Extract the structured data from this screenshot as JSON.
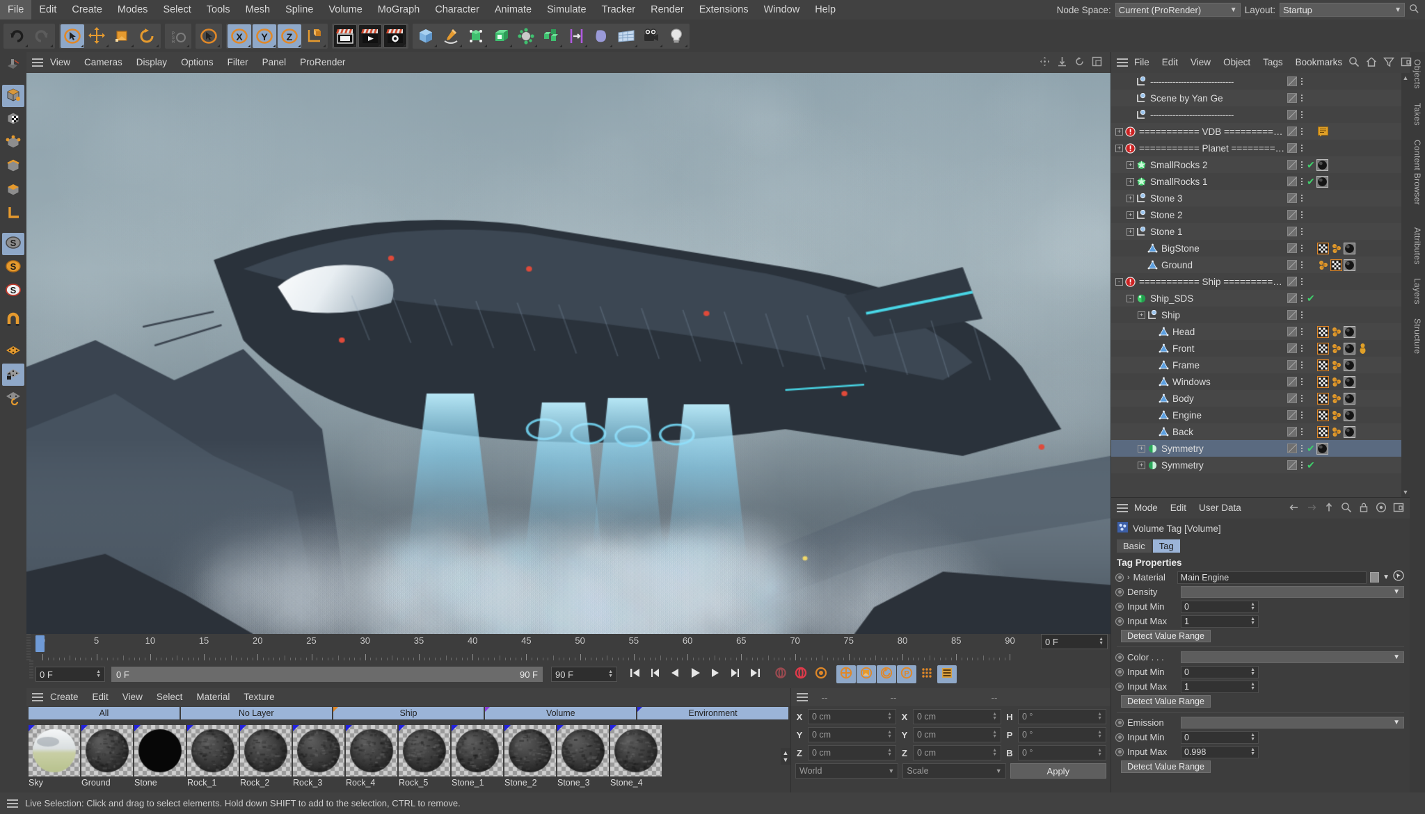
{
  "app": {
    "menubar": [
      "File",
      "Edit",
      "Create",
      "Modes",
      "Select",
      "Tools",
      "Mesh",
      "Spline",
      "Volume",
      "MoGraph",
      "Character",
      "Animate",
      "Simulate",
      "Tracker",
      "Render",
      "Extensions",
      "Window",
      "Help"
    ],
    "node_space_label": "Node Space:",
    "node_space_value": "Current (ProRender)",
    "layout_label": "Layout:",
    "layout_value": "Startup",
    "search_icon": "search-icon"
  },
  "toolbar": {
    "groups": [
      {
        "name": "history",
        "buttons": [
          {
            "icon": "undo-icon",
            "active": false
          },
          {
            "icon": "redo-icon",
            "active": false
          }
        ]
      },
      {
        "name": "transform",
        "buttons": [
          {
            "icon": "live-selection-icon",
            "active": true
          },
          {
            "icon": "move-icon",
            "active": false
          },
          {
            "icon": "scale-icon",
            "active": false
          },
          {
            "icon": "rotate-icon",
            "active": false
          }
        ]
      },
      {
        "name": "workplane",
        "buttons": [
          {
            "icon": "workplane-icon",
            "active": false
          }
        ]
      },
      {
        "name": "selection",
        "buttons": [
          {
            "icon": "cursor-select-icon",
            "active": false
          }
        ]
      },
      {
        "name": "axes",
        "buttons": [
          {
            "icon": "axis-x-icon",
            "active": true
          },
          {
            "icon": "axis-y-icon",
            "active": true
          },
          {
            "icon": "axis-z-icon",
            "active": true
          },
          {
            "icon": "world-object-axis-icon",
            "active": false
          }
        ]
      },
      {
        "name": "render",
        "buttons": [
          {
            "icon": "render-view-icon",
            "active": false
          },
          {
            "icon": "render-queue-icon",
            "active": false
          },
          {
            "icon": "render-settings-icon",
            "active": false
          }
        ]
      },
      {
        "name": "primitives",
        "buttons": [
          {
            "icon": "cube-icon",
            "active": false
          },
          {
            "icon": "pen-spline-icon",
            "active": false
          },
          {
            "icon": "nurbs-icon",
            "active": false
          },
          {
            "icon": "array-icon",
            "active": false
          },
          {
            "icon": "mograph-icon",
            "active": false
          },
          {
            "icon": "cloner-icon",
            "active": false
          },
          {
            "icon": "deformer-icon",
            "active": false
          },
          {
            "icon": "field-icon",
            "active": false
          },
          {
            "icon": "environment-icon",
            "active": false
          },
          {
            "icon": "camera-icon",
            "active": false
          },
          {
            "icon": "light-icon",
            "active": false
          }
        ]
      }
    ]
  },
  "left_rail": [
    {
      "icon": "texture-axis-icon",
      "active": false
    },
    {
      "icon": "model-mode-icon",
      "active": true
    },
    {
      "icon": "texture-mode-icon",
      "active": false
    },
    {
      "icon": "points-mode-icon",
      "active": false
    },
    {
      "icon": "edges-mode-icon",
      "active": false
    },
    {
      "icon": "polygons-mode-icon",
      "active": false
    },
    {
      "icon": "axis-mode-icon",
      "active": false
    },
    {
      "icon": "enable-axis-icon",
      "active": true
    },
    {
      "icon": "soft-selection-icon",
      "active": false
    },
    {
      "icon": "snap-toggle-icon",
      "active": false
    },
    {
      "icon": "magnet-icon",
      "active": false
    },
    {
      "icon": "workplane-grid-icon",
      "active": false
    },
    {
      "icon": "workplane-lock-icon",
      "active": true
    },
    {
      "icon": "workplane-rotate-icon",
      "active": false
    }
  ],
  "viewport": {
    "menu": [
      "View",
      "Cameras",
      "Display",
      "Options",
      "Filter",
      "Panel",
      "ProRender"
    ],
    "right_icons": [
      "pan-icon",
      "dolly-icon",
      "rotate-view-icon",
      "maximize-view-icon"
    ]
  },
  "timeline": {
    "ticks": [
      0,
      5,
      10,
      15,
      20,
      25,
      30,
      35,
      40,
      45,
      50,
      55,
      60,
      65,
      70,
      75,
      80,
      85,
      90
    ],
    "playhead_frame": 0,
    "current_frame": "0 F",
    "range_start": "0 F",
    "range_end": "90 F",
    "preview_min": "90 F",
    "preview_max": "90 F",
    "end_field": "0 F",
    "transport": [
      {
        "icon": "go-to-start-icon",
        "style": "plain"
      },
      {
        "icon": "rewind-to-previous-key-icon",
        "style": "plain"
      },
      {
        "icon": "step-back-icon",
        "style": "plain"
      },
      {
        "icon": "play-icon",
        "style": "plain"
      },
      {
        "icon": "step-forward-icon",
        "style": "plain"
      },
      {
        "icon": "forward-to-next-key-icon",
        "style": "plain"
      },
      {
        "icon": "go-to-end-icon",
        "style": "plain"
      },
      {
        "icon": "record-active-objects-icon",
        "style": "plain"
      },
      {
        "icon": "autokeying-icon",
        "style": "plain"
      },
      {
        "icon": "keyframe-selection-icon",
        "style": "plain"
      },
      {
        "icon": "position-key-icon",
        "style": "blue"
      },
      {
        "icon": "scale-key-icon",
        "style": "blue"
      },
      {
        "icon": "rotation-key-icon",
        "style": "blue"
      },
      {
        "icon": "parameter-key-icon",
        "style": "blue"
      },
      {
        "icon": "point-level-animation-icon",
        "style": "plain"
      },
      {
        "icon": "timeline-toggle-icon",
        "style": "blue"
      }
    ]
  },
  "material_manager": {
    "menu": [
      "Create",
      "Edit",
      "View",
      "Select",
      "Material",
      "Texture"
    ],
    "layer_tabs": [
      "All",
      "No Layer",
      "Ship",
      "Volume",
      "Environment"
    ],
    "materials": [
      {
        "name": "Sky",
        "swatch": "sky"
      },
      {
        "name": "Ground",
        "swatch": "rock"
      },
      {
        "name": "Stone",
        "swatch": "black"
      },
      {
        "name": "Rock_1",
        "swatch": "rock"
      },
      {
        "name": "Rock_2",
        "swatch": "rock"
      },
      {
        "name": "Rock_3",
        "swatch": "rock"
      },
      {
        "name": "Rock_4",
        "swatch": "rock"
      },
      {
        "name": "Rock_5",
        "swatch": "rock"
      },
      {
        "name": "Stone_1",
        "swatch": "rock"
      },
      {
        "name": "Stone_2",
        "swatch": "rock"
      },
      {
        "name": "Stone_3",
        "swatch": "rock"
      },
      {
        "name": "Stone_4",
        "swatch": "rock"
      }
    ]
  },
  "coordinates": {
    "headers": [
      "--",
      "--",
      "--"
    ],
    "position": [
      {
        "axis": "X",
        "value": "0 cm"
      },
      {
        "axis": "Y",
        "value": "0 cm"
      },
      {
        "axis": "Z",
        "value": "0 cm"
      }
    ],
    "size": [
      {
        "axis": "X",
        "value": "0 cm"
      },
      {
        "axis": "Y",
        "value": "0 cm"
      },
      {
        "axis": "Z",
        "value": "0 cm"
      }
    ],
    "rotation": [
      {
        "axis": "H",
        "value": "0 °"
      },
      {
        "axis": "P",
        "value": "0 °"
      },
      {
        "axis": "B",
        "value": "0 °"
      }
    ],
    "system": "World",
    "mode": "Scale",
    "apply_label": "Apply"
  },
  "object_manager": {
    "menu": [
      "File",
      "Edit",
      "View",
      "Object",
      "Tags",
      "Bookmarks"
    ],
    "icons": [
      "search-icon",
      "home-icon",
      "filter-icon",
      "fullscreen-icon"
    ],
    "rows": [
      {
        "name": "------------------------------",
        "icon": "null-object",
        "indent": 1,
        "expander": "",
        "check": false,
        "tags": [],
        "dashed": true
      },
      {
        "name": "Scene by Yan Ge",
        "icon": "null-object",
        "indent": 1,
        "expander": "",
        "check": false,
        "tags": []
      },
      {
        "name": "------------------------------",
        "icon": "null-object",
        "indent": 1,
        "expander": "",
        "check": false,
        "tags": [],
        "dashed": true
      },
      {
        "name": "=========== VDB ============",
        "icon": "error",
        "indent": 0,
        "expander": "+",
        "check": false,
        "tags": [
          "annotation"
        ]
      },
      {
        "name": "=========== Planet ===========",
        "icon": "error",
        "indent": 0,
        "expander": "+",
        "check": false,
        "tags": []
      },
      {
        "name": "SmallRocks 2",
        "icon": "cloner",
        "indent": 1,
        "expander": "+",
        "check": true,
        "tags": [
          "sphere-dark"
        ]
      },
      {
        "name": "SmallRocks 1",
        "icon": "cloner",
        "indent": 1,
        "expander": "+",
        "check": true,
        "tags": [
          "sphere-dark"
        ]
      },
      {
        "name": "Stone 3",
        "icon": "null-object",
        "indent": 1,
        "expander": "+",
        "check": false,
        "tags": []
      },
      {
        "name": "Stone 2",
        "icon": "null-object",
        "indent": 1,
        "expander": "+",
        "check": false,
        "tags": []
      },
      {
        "name": "Stone 1",
        "icon": "null-object",
        "indent": 1,
        "expander": "+",
        "check": false,
        "tags": []
      },
      {
        "name": "BigStone",
        "icon": "polygon",
        "indent": 2,
        "expander": "",
        "check": false,
        "tags": [
          "uv",
          "selection",
          "sphere-dark"
        ]
      },
      {
        "name": "Ground",
        "icon": "polygon",
        "indent": 2,
        "expander": "",
        "check": false,
        "tags": [
          "selection",
          "uv",
          "sphere-dark"
        ]
      },
      {
        "name": "=========== Ship ============",
        "icon": "error",
        "indent": 0,
        "expander": "-",
        "check": false,
        "tags": []
      },
      {
        "name": "Ship_SDS",
        "icon": "subdivision",
        "indent": 1,
        "expander": "-",
        "check": true,
        "tags": []
      },
      {
        "name": "Ship",
        "icon": "null-object",
        "indent": 2,
        "expander": "+",
        "check": false,
        "tags": []
      },
      {
        "name": "Head",
        "icon": "polygon",
        "indent": 3,
        "expander": "",
        "check": false,
        "tags": [
          "uv",
          "selection",
          "sphere-dark"
        ]
      },
      {
        "name": "Front",
        "icon": "polygon",
        "indent": 3,
        "expander": "",
        "check": false,
        "tags": [
          "uv",
          "selection",
          "sphere-dark",
          "volume"
        ]
      },
      {
        "name": "Frame",
        "icon": "polygon",
        "indent": 3,
        "expander": "",
        "check": false,
        "tags": [
          "uv",
          "selection",
          "sphere-dark"
        ]
      },
      {
        "name": "Windows",
        "icon": "polygon",
        "indent": 3,
        "expander": "",
        "check": false,
        "tags": [
          "uv",
          "selection",
          "sphere-dark"
        ]
      },
      {
        "name": "Body",
        "icon": "polygon",
        "indent": 3,
        "expander": "",
        "check": false,
        "tags": [
          "uv",
          "selection",
          "sphere-dark"
        ]
      },
      {
        "name": "Engine",
        "icon": "polygon",
        "indent": 3,
        "expander": "",
        "check": false,
        "tags": [
          "uv",
          "selection",
          "sphere-dark"
        ]
      },
      {
        "name": "Back",
        "icon": "polygon",
        "indent": 3,
        "expander": "",
        "check": false,
        "tags": [
          "uv",
          "selection",
          "sphere-dark"
        ]
      },
      {
        "name": "Symmetry",
        "icon": "symmetry",
        "indent": 2,
        "expander": "+",
        "check": true,
        "tags": [
          "sphere-dark"
        ],
        "selected": true
      },
      {
        "name": "Symmetry",
        "icon": "symmetry",
        "indent": 2,
        "expander": "+",
        "check": true,
        "tags": []
      }
    ]
  },
  "attributes": {
    "menu": [
      "Mode",
      "Edit",
      "User Data"
    ],
    "icons": [
      "back-arrow-icon",
      "forward-arrow-icon",
      "up-arrow-icon",
      "search-icon",
      "lock-icon",
      "target-icon",
      "fullscreen-icon"
    ],
    "object_title": "Volume Tag [Volume]",
    "tabs": [
      {
        "label": "Basic",
        "active": false
      },
      {
        "label": "Tag",
        "active": true
      }
    ],
    "section_title": "Tag Properties",
    "material_label": "Material",
    "material_value": "Main Engine",
    "groups": [
      {
        "label": "Density",
        "dropdown": "",
        "input_min": "0",
        "input_max": "1",
        "button": "Detect Value Range"
      },
      {
        "label": "Color . . .",
        "dropdown": "",
        "input_min": "0",
        "input_max": "1",
        "button": "Detect Value Range"
      },
      {
        "label": "Emission",
        "dropdown": "",
        "input_min": "0",
        "input_max": "0.998",
        "button": "Detect Value Range"
      }
    ],
    "field_min_label": "Input Min",
    "field_max_label": "Input Max"
  },
  "right_tabs": [
    "Objects",
    "Takes",
    "Content Browser",
    "Attributes",
    "Layers",
    "Structure"
  ],
  "status": {
    "text": "Live Selection: Click and drag to select elements. Hold down SHIFT to add to the selection, CTRL to remove.",
    "menu_icon": "hamburger-icon"
  },
  "colors": {
    "accent_blue": "#8fa8c8",
    "orange": "#e08828",
    "green_check": "#3fcf6b",
    "error_red": "#cc2222",
    "panel_bg": "#3d3d3d"
  }
}
